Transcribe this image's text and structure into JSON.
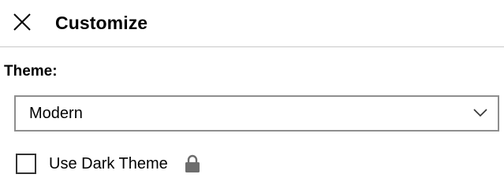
{
  "header": {
    "close_icon": "close-icon",
    "title": "Customize"
  },
  "theme": {
    "label": "Theme:",
    "selected": "Modern",
    "chevron_icon": "chevron-down-icon"
  },
  "dark_theme": {
    "label": "Use Dark Theme",
    "checked": false,
    "lock_icon": "lock-icon"
  },
  "colors": {
    "text": "#000000",
    "divider": "#c8c8c8",
    "select_border": "#8e8e8e",
    "checkbox_border": "#333333",
    "lock": "#6d6d6d"
  }
}
